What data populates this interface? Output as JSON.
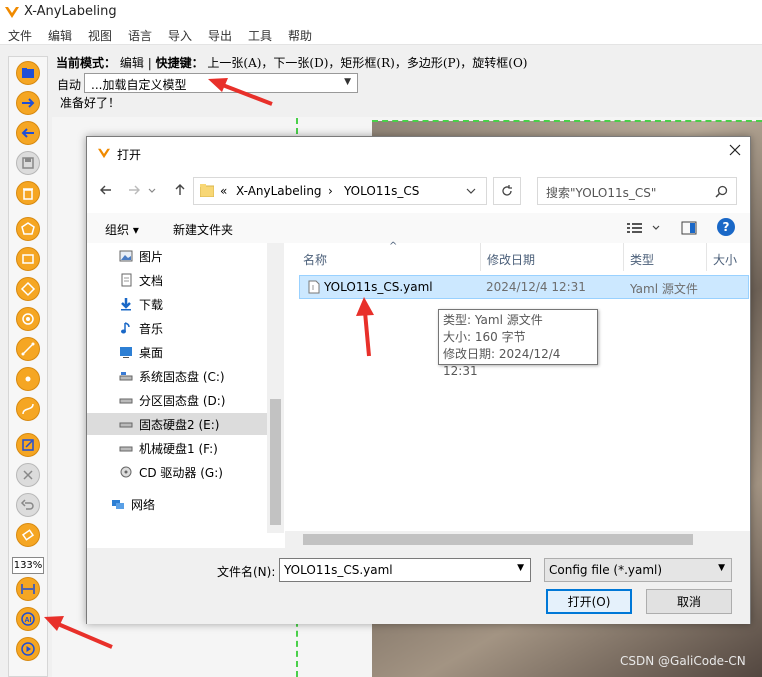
{
  "app": {
    "title": "X-AnyLabeling",
    "menu": [
      "文件",
      "编辑",
      "视图",
      "语言",
      "导入",
      "导出",
      "工具",
      "帮助"
    ]
  },
  "info": {
    "mode_label": "当前模式：",
    "mode_value": "编辑",
    "separator": "|",
    "shortcut_label": "快捷键：",
    "shortcuts": "上一张(A)，下一张(D)，矩形框(R)，多边形(P)，旋转框(O)",
    "auto_label": "自动",
    "model_select": "...加载自定义模型",
    "status": "准备好了！"
  },
  "toolbar": {
    "zoom": "133%",
    "icons": [
      "open-folder-icon",
      "next-image-icon",
      "prev-image-icon",
      "save-icon",
      "delete-icon",
      "polygon-icon",
      "rectangle-icon",
      "rotation-icon",
      "circle-icon",
      "line-icon",
      "point-icon",
      "linestrip-icon",
      "edit-icon",
      "close-icon",
      "undo-icon",
      "brush-icon",
      "fit-width-icon",
      "ai-icon",
      "play-icon"
    ]
  },
  "dialog": {
    "title": "打开",
    "breadcrumb": [
      "«",
      "X-AnyLabeling",
      "›",
      "YOLO11s_CS"
    ],
    "search_placeholder": "搜索\"YOLO11s_CS\"",
    "organize": "组织 ▾",
    "new_folder": "新建文件夹",
    "nav_items": [
      "图片",
      "文档",
      "下载",
      "音乐",
      "桌面",
      "系统固态盘 (C:)",
      "分区固态盘 (D:)",
      "固态硬盘2 (E:)",
      "机械硬盘1 (F:)",
      "CD 驱动器 (G:)",
      "网络"
    ],
    "columns": [
      "名称",
      "修改日期",
      "类型",
      "大小"
    ],
    "file": {
      "name": "YOLO11s_CS.yaml",
      "date": "2024/12/4 12:31",
      "type": "Yaml 源文件"
    },
    "tooltip": {
      "type": "类型: Yaml 源文件",
      "size": "大小: 160 字节",
      "date": "修改日期: 2024/12/4 12:31"
    },
    "filename_label": "文件名(N):",
    "filename_value": "YOLO11s_CS.yaml",
    "filter": "Config file (*.yaml)",
    "open_button": "打开(O)",
    "cancel_button": "取消"
  },
  "watermark": "CSDN @GaliCode-CN",
  "colors": {
    "accent": "#f5a623",
    "selection": "#cce8ff",
    "arrow": "#e8302a",
    "guide": "#4ad04a"
  }
}
